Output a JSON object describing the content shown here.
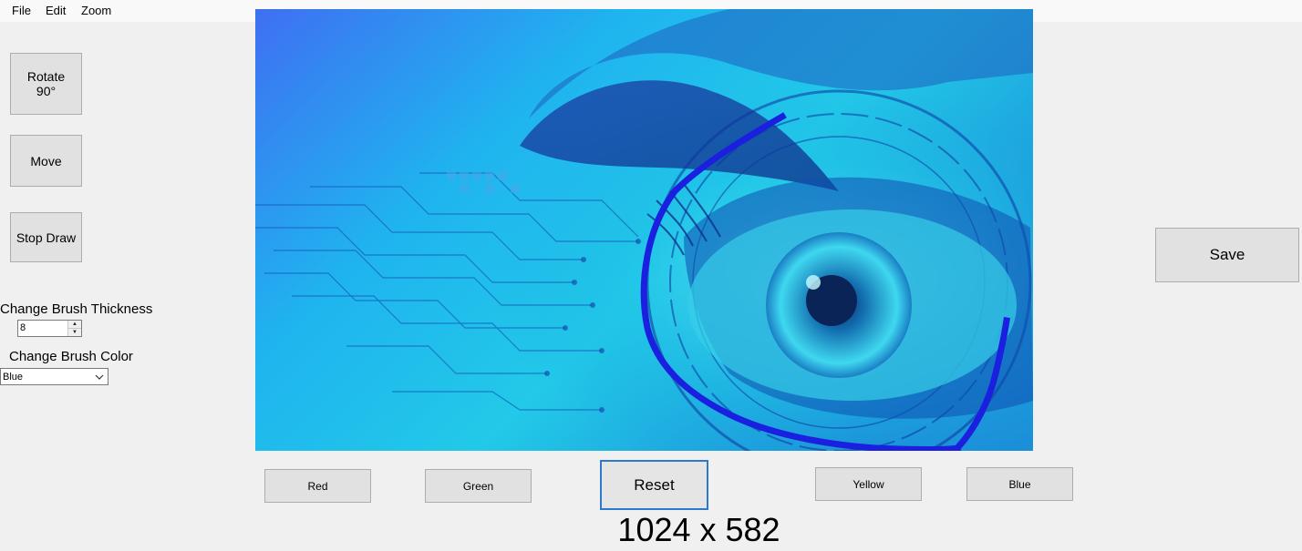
{
  "menu": {
    "file": "File",
    "edit": "Edit",
    "zoom": "Zoom"
  },
  "left_panel": {
    "rotate_label": "Rotate 90°",
    "move_label": "Move",
    "stop_draw_label": "Stop Draw",
    "thickness_label": "Change Brush Thickness",
    "thickness_value": "8",
    "color_label": "Change Brush Color",
    "color_value": "Blue"
  },
  "color_buttons": {
    "red": "Red",
    "green": "Green",
    "yellow": "Yellow",
    "blue": "Blue"
  },
  "reset_label": "Reset",
  "save_label": "Save",
  "image_dimensions": "1024 x 582",
  "colors": {
    "window_bg": "#f0f0f0",
    "button_bg": "#e1e1e1",
    "focus_border": "#2b7ad0",
    "brush_stroke": "#1a1fe0"
  },
  "canvas": {
    "image_description_icon": "eye-circuit-image"
  }
}
